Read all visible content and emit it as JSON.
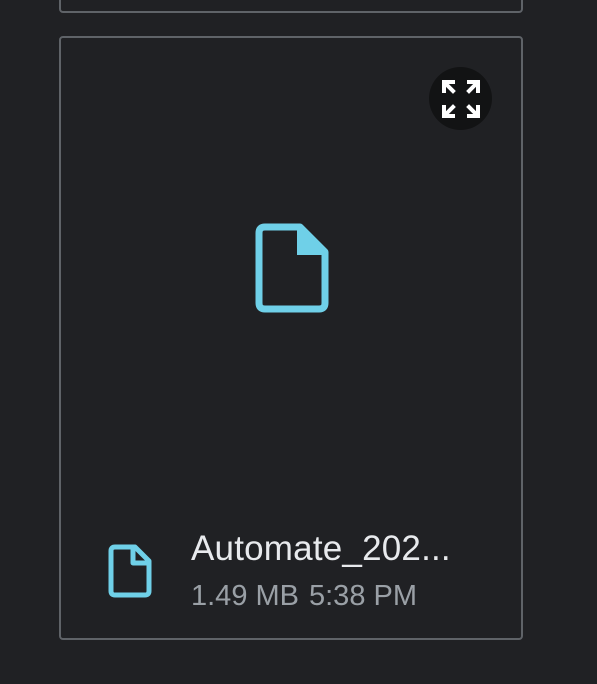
{
  "attachment": {
    "file_name": "Automate_202...",
    "file_size": "1.49 MB",
    "time": "5:38 PM",
    "icon_color": "#6fd0e8",
    "icons": {
      "expand": "expand-icon",
      "preview": "file-icon",
      "footer": "file-icon"
    }
  },
  "colors": {
    "background": "#202124",
    "border": "#5f6368",
    "name_text": "#e8eaed",
    "meta_text": "#9aa0a6"
  }
}
